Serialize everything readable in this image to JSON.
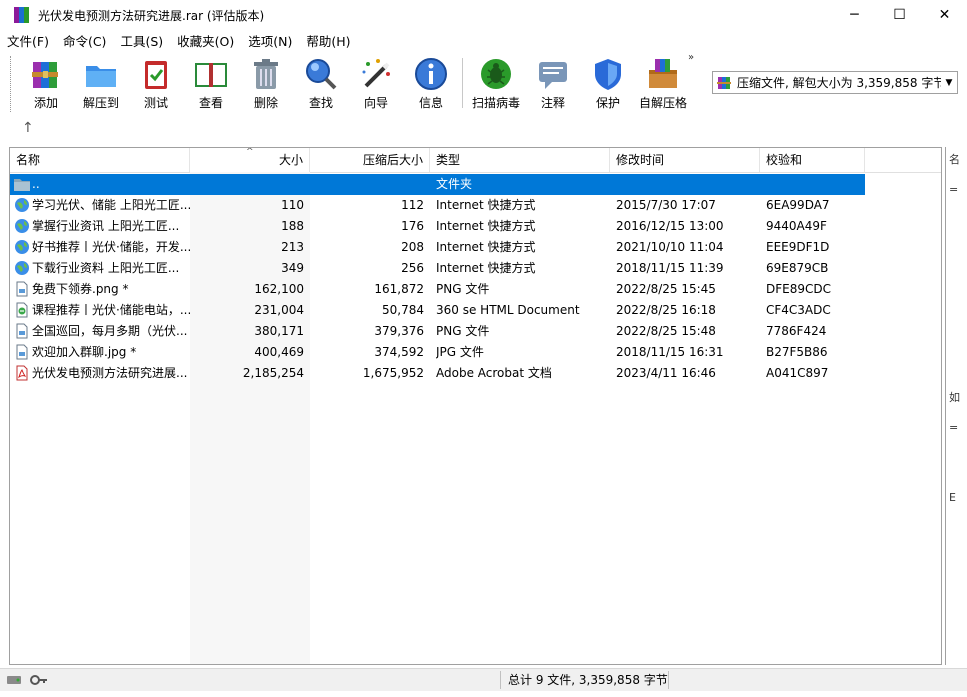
{
  "window": {
    "title": "光伏发电预测方法研究进展.rar (评估版本)",
    "minimize": "─",
    "maximize": "☐",
    "close": "✕"
  },
  "menu": [
    "文件(F)",
    "命令(C)",
    "工具(S)",
    "收藏夹(O)",
    "选项(N)",
    "帮助(H)"
  ],
  "toolbar": {
    "add": "添加",
    "extract_to": "解压到",
    "test": "测试",
    "view": "查看",
    "delete": "删除",
    "find": "查找",
    "wizard": "向导",
    "info": "信息",
    "virus_scan": "扫描病毒",
    "comment": "注释",
    "protect": "保护",
    "sfx": "自解压格",
    "more": "»"
  },
  "archive_info": "压缩文件, 解包大小为 3,359,858 字节",
  "columns": {
    "name": "名称",
    "size": "大小",
    "packed": "压缩后大小",
    "type": "类型",
    "modified": "修改时间",
    "crc": "校验和"
  },
  "parent_row": {
    "name": "..",
    "type": "文件夹"
  },
  "files": [
    {
      "name": "学习光伏、储能 上阳光工匠...",
      "size": "110",
      "packed": "112",
      "type": "Internet 快捷方式",
      "modified": "2015/7/30 17:07",
      "crc": "6EA99DA7",
      "icon": "globe-icon"
    },
    {
      "name": "掌握行业资讯 上阳光工匠...",
      "size": "188",
      "packed": "176",
      "type": "Internet 快捷方式",
      "modified": "2016/12/15 13:00",
      "crc": "9440A49F",
      "icon": "globe-icon"
    },
    {
      "name": "好书推荐丨光伏·储能，开发...",
      "size": "213",
      "packed": "208",
      "type": "Internet 快捷方式",
      "modified": "2021/10/10 11:04",
      "crc": "EEE9DF1D",
      "icon": "globe-icon"
    },
    {
      "name": "下载行业资料 上阳光工匠...",
      "size": "349",
      "packed": "256",
      "type": "Internet 快捷方式",
      "modified": "2018/11/15 11:39",
      "crc": "69E879CB",
      "icon": "globe-icon"
    },
    {
      "name": "免费下领券.png *",
      "size": "162,100",
      "packed": "161,872",
      "type": "PNG 文件",
      "modified": "2022/8/25 15:45",
      "crc": "DFE89CDC",
      "icon": "image-file-icon"
    },
    {
      "name": "课程推荐丨光伏·储能电站，...",
      "size": "231,004",
      "packed": "50,784",
      "type": "360 se HTML Document",
      "modified": "2022/8/25 16:18",
      "crc": "CF4C3ADC",
      "icon": "html-file-icon"
    },
    {
      "name": "全国巡回，每月多期（光伏...",
      "size": "380,171",
      "packed": "379,376",
      "type": "PNG 文件",
      "modified": "2022/8/25 15:48",
      "crc": "7786F424",
      "icon": "image-file-icon"
    },
    {
      "name": "欢迎加入群聊.jpg *",
      "size": "400,469",
      "packed": "374,592",
      "type": "JPG 文件",
      "modified": "2018/11/15 16:31",
      "crc": "B27F5B86",
      "icon": "image-file-icon"
    },
    {
      "name": "光伏发电预测方法研究进展...",
      "size": "2,185,254",
      "packed": "1,675,952",
      "type": "Adobe Acrobat 文档",
      "modified": "2023/4/11 16:46",
      "crc": "A041C897",
      "icon": "pdf-file-icon"
    }
  ],
  "right_panel": [
    "名",
    "",
    "如",
    "",
    "E"
  ],
  "status": "总计 9 文件, 3,359,858 字节"
}
